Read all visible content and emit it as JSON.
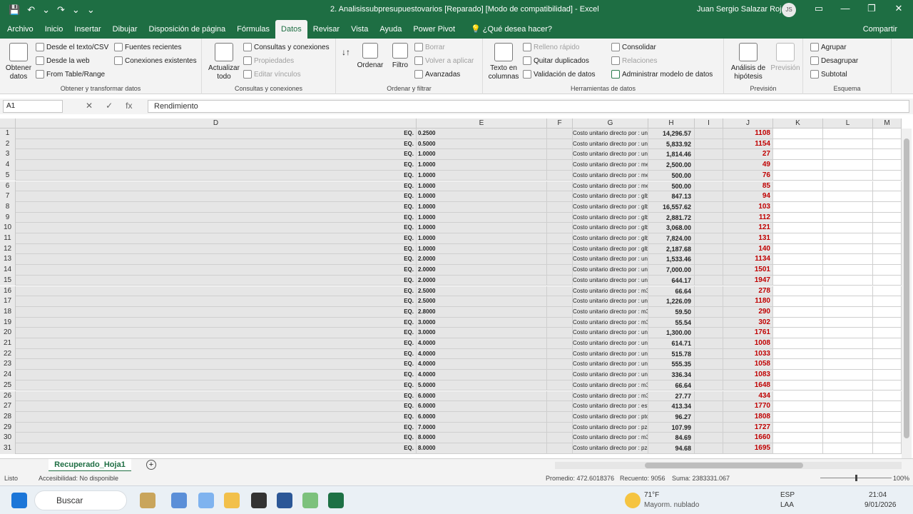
{
  "window": {
    "title": "2. Analisissubpresupuestovarios [Reparado]  [Modo de compatibilidad]  -  Excel",
    "user": "Juan Sergio Salazar Rojas",
    "user_initials": "JS",
    "qat": [
      "💾",
      "↶",
      "⌄",
      "↷",
      "⌄",
      "⌄"
    ],
    "win_controls": [
      "▭",
      "—",
      "❐",
      "✕"
    ]
  },
  "menu": {
    "tabs": [
      "Archivo",
      "Inicio",
      "Insertar",
      "Dibujar",
      "Disposición de página",
      "Fórmulas",
      "Datos",
      "Revisar",
      "Vista",
      "Ayuda",
      "Power Pivot"
    ],
    "help_icon": "💡",
    "help": "¿Qué desea hacer?",
    "share": "Compartir"
  },
  "ribbon": {
    "g1": {
      "obtener_1": "Obtener",
      "obtener_2": "datos",
      "t1": "Desde el texto/CSV",
      "t2": "Desde la web",
      "t3": "From Table/Range",
      "t4": "Fuentes recientes",
      "t5": "Conexiones existentes",
      "label": "Obtener y transformar datos"
    },
    "g2": {
      "act_1": "Actualizar",
      "act_2": "todo",
      "t1": "Consultas y conexiones",
      "t2": "Propiedades",
      "t3": "Editar vínculos",
      "label": "Consultas y conexiones"
    },
    "g3": {
      "ordenar": "Ordenar",
      "filtro": "Filtro",
      "t1": "Borrar",
      "t2": "Volver a aplicar",
      "t3": "Avanzadas",
      "label": "Ordenar y filtrar"
    },
    "g4": {
      "texto_1": "Texto en",
      "texto_2": "columnas",
      "t1": "Relleno rápido",
      "t2": "Quitar duplicados",
      "t3": "Validación de datos",
      "t4": "Consolidar",
      "t5": "Relaciones",
      "t6": "Administrar modelo de datos",
      "label": "Herramientas de datos"
    },
    "g5": {
      "ana_1": "Análisis de",
      "ana_2": "hipótesis",
      "prev": "Previsión",
      "label": "Previsión"
    },
    "g6": {
      "t1": "Agrupar",
      "t2": "Desagrupar",
      "t3": "Subtotal",
      "label": "Esquema"
    }
  },
  "formula": {
    "namebox": "A1",
    "fx_icons": [
      "✕",
      "✓",
      "fx"
    ],
    "content": "Rendimiento"
  },
  "columns": [
    "D",
    "E",
    "F",
    "G",
    "H",
    "I",
    "J",
    "K",
    "L",
    "M"
  ],
  "rows": [
    {
      "n": "1",
      "e": "0.2500",
      "g": "Costo unitario directo por : und",
      "h": "14,296.57",
      "j": "1108"
    },
    {
      "n": "2",
      "e": "0.5000",
      "g": "Costo unitario directo por : und",
      "h": "5,833.92",
      "j": "1154"
    },
    {
      "n": "3",
      "e": "1.0000",
      "g": "Costo unitario directo por : und",
      "h": "1,814.46",
      "j": "27"
    },
    {
      "n": "4",
      "e": "1.0000",
      "g": "Costo unitario directo por : mes",
      "h": "2,500.00",
      "j": "49"
    },
    {
      "n": "5",
      "e": "1.0000",
      "g": "Costo unitario directo por : mes",
      "h": "500.00",
      "j": "76"
    },
    {
      "n": "6",
      "e": "1.0000",
      "g": "Costo unitario directo por : mes",
      "h": "500.00",
      "j": "85"
    },
    {
      "n": "7",
      "e": "1.0000",
      "g": "Costo unitario directo por : glb",
      "h": "847.13",
      "j": "94"
    },
    {
      "n": "8",
      "e": "1.0000",
      "g": "Costo unitario directo por : glb",
      "h": "16,557.62",
      "j": "103"
    },
    {
      "n": "9",
      "e": "1.0000",
      "g": "Costo unitario directo por : glb",
      "h": "2,881.72",
      "j": "112"
    },
    {
      "n": "10",
      "e": "1.0000",
      "g": "Costo unitario directo por : glb",
      "h": "3,068.00",
      "j": "121"
    },
    {
      "n": "11",
      "e": "1.0000",
      "g": "Costo unitario directo por : glb",
      "h": "7,824.00",
      "j": "131"
    },
    {
      "n": "12",
      "e": "1.0000",
      "g": "Costo unitario directo por : glb",
      "h": "2,187.68",
      "j": "140"
    },
    {
      "n": "13",
      "e": "2.0000",
      "g": "Costo unitario directo por : und",
      "h": "1,533.46",
      "j": "1134"
    },
    {
      "n": "14",
      "e": "2.0000",
      "g": "Costo unitario directo por : und",
      "h": "7,000.00",
      "j": "1501"
    },
    {
      "n": "15",
      "e": "2.0000",
      "g": "Costo unitario directo por : und",
      "h": "644.17",
      "j": "1947"
    },
    {
      "n": "16",
      "e": "2.5000",
      "g": "Costo unitario directo por : m3",
      "h": "66.64",
      "j": "278"
    },
    {
      "n": "17",
      "e": "2.5000",
      "g": "Costo unitario directo por : und",
      "h": "1,226.09",
      "j": "1180"
    },
    {
      "n": "18",
      "e": "2.8000",
      "g": "Costo unitario directo por : m3",
      "h": "59.50",
      "j": "290"
    },
    {
      "n": "19",
      "e": "3.0000",
      "g": "Costo unitario directo por : m3",
      "h": "55.54",
      "j": "302"
    },
    {
      "n": "20",
      "e": "3.0000",
      "g": "Costo unitario directo por : und",
      "h": "1,300.00",
      "j": "1761"
    },
    {
      "n": "21",
      "e": "4.0000",
      "g": "Costo unitario directo por : und",
      "h": "614.71",
      "j": "1008"
    },
    {
      "n": "22",
      "e": "4.0000",
      "g": "Costo unitario directo por : und",
      "h": "515.78",
      "j": "1033"
    },
    {
      "n": "23",
      "e": "4.0000",
      "g": "Costo unitario directo por : und",
      "h": "555.35",
      "j": "1058"
    },
    {
      "n": "24",
      "e": "4.0000",
      "g": "Costo unitario directo por : und",
      "h": "336.34",
      "j": "1083"
    },
    {
      "n": "25",
      "e": "5.0000",
      "g": "Costo unitario directo por : m3",
      "h": "66.64",
      "j": "1648"
    },
    {
      "n": "26",
      "e": "6.0000",
      "g": "Costo unitario directo por : m3",
      "h": "27.77",
      "j": "434"
    },
    {
      "n": "27",
      "e": "6.0000",
      "g": "Costo unitario directo por : est",
      "h": "413.34",
      "j": "1770"
    },
    {
      "n": "28",
      "e": "6.0000",
      "g": "Costo unitario directo por : pto",
      "h": "96.27",
      "j": "1808"
    },
    {
      "n": "29",
      "e": "7.0000",
      "g": "Costo unitario directo por : pza",
      "h": "107.99",
      "j": "1727"
    },
    {
      "n": "30",
      "e": "8.0000",
      "g": "Costo unitario directo por : m3",
      "h": "84.69",
      "j": "1660"
    },
    {
      "n": "31",
      "e": "8.0000",
      "g": "Costo unitario directo por : pza",
      "h": "94.68",
      "j": "1695"
    }
  ],
  "eq_prefix": "EQ.",
  "sheet": {
    "tab": "Recuperado_Hoja1",
    "add": "+"
  },
  "status": {
    "ready": "Listo",
    "accessibility": "Accesibilidad: No disponible",
    "promedio": "Promedio: 472.6018376",
    "recuento": "Recuento: 9056",
    "suma": "Suma: 2383331.067",
    "zoom": "100%",
    "zoom_level_pct": 100
  },
  "taskbar": {
    "search": "Buscar",
    "weather_temp": "71°F",
    "weather_desc": "Mayorm. nublado",
    "lang_1": "ESP",
    "lang_2": "LAA",
    "time": "21:04",
    "date": "9/01/2026"
  }
}
